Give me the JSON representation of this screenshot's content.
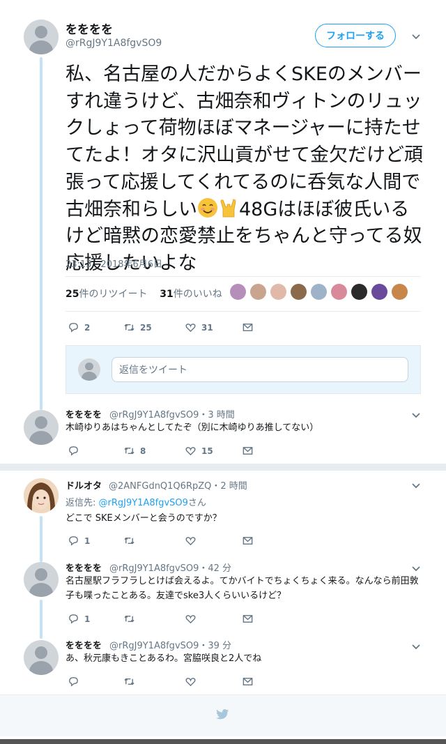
{
  "main_tweet": {
    "name": "をををを",
    "handle": "@rRgJ9Y1A8fgvSO9",
    "follow_label": "フォローする",
    "text_before_emoji": "私、名古屋の人だからよくSKEのメンバーすれ違うけど、古畑奈和ヴィトンのリュックしょって荷物ほぼマネージャーに持たせてたよ！オタに沢山貢がせて金欠だけど頑張って応援してくれてるのに呑気な人間で古畑奈和らしい",
    "text_after_emoji": "48Gはほぼ彼氏いるけど暗黙の恋愛禁止をちゃんと守ってる奴応援したいよな",
    "emoji_icons": [
      "smiling-face-icon",
      "rock-hand-icon"
    ],
    "timestamp": "23:13 - 2018年6月6日",
    "retweet_count": "25",
    "retweet_label": "件のリツイート",
    "like_count": "31",
    "like_label": "件のいいね",
    "liker_colors": [
      "#b58fb8",
      "#c9a48f",
      "#e0b9a8",
      "#8a6a4a",
      "#9fb3c8",
      "#d88a9a",
      "#2b2b2b",
      "#6a4a9a",
      "#c8864a"
    ],
    "actions": {
      "reply": "2",
      "retweet": "25",
      "like": "31"
    }
  },
  "reply_composer": {
    "placeholder": "返信をツイート"
  },
  "replies": [
    {
      "name": "をををを",
      "meta": "@rRgJ9Y1A8fgvSO9・3 時間",
      "text": "木崎ゆりあはちゃんとしてたぞ（別に木崎ゆりあ推してない）",
      "actions": {
        "reply": "",
        "retweet": "8",
        "like": "15"
      }
    },
    {
      "name": "ドルオタ",
      "meta": "@2ANFGdnQ1Q6RpZQ・2 時間",
      "reply_to_label": "返信先: ",
      "reply_to_handle": "@rRgJ9Y1A8fgvSO9",
      "reply_to_suffix": "さん",
      "text": "どこで SKEメンバーと会うのですか？",
      "actions": {
        "reply": "1",
        "retweet": "",
        "like": ""
      }
    },
    {
      "name": "をををを",
      "meta": "@rRgJ9Y1A8fgvSO9・42 分",
      "text": "名古屋駅フラフラしとけば会えるよ。てかバイトでちょくちょく来る。なんなら前田敦子も喋ったことある。友達でske3人くらいいるけど？",
      "actions": {
        "reply": "1",
        "retweet": "",
        "like": ""
      }
    },
    {
      "name": "をををを",
      "meta": "@rRgJ9Y1A8fgvSO9・39 分",
      "text": "あ、秋元康もきことあるわ。宮脇咲良と2人でね",
      "actions": {
        "reply": "",
        "retweet": "",
        "like": ""
      }
    }
  ],
  "colors": {
    "accent": "#1da1f2",
    "muted": "#657786",
    "thread_line": "#c4e2f7"
  }
}
